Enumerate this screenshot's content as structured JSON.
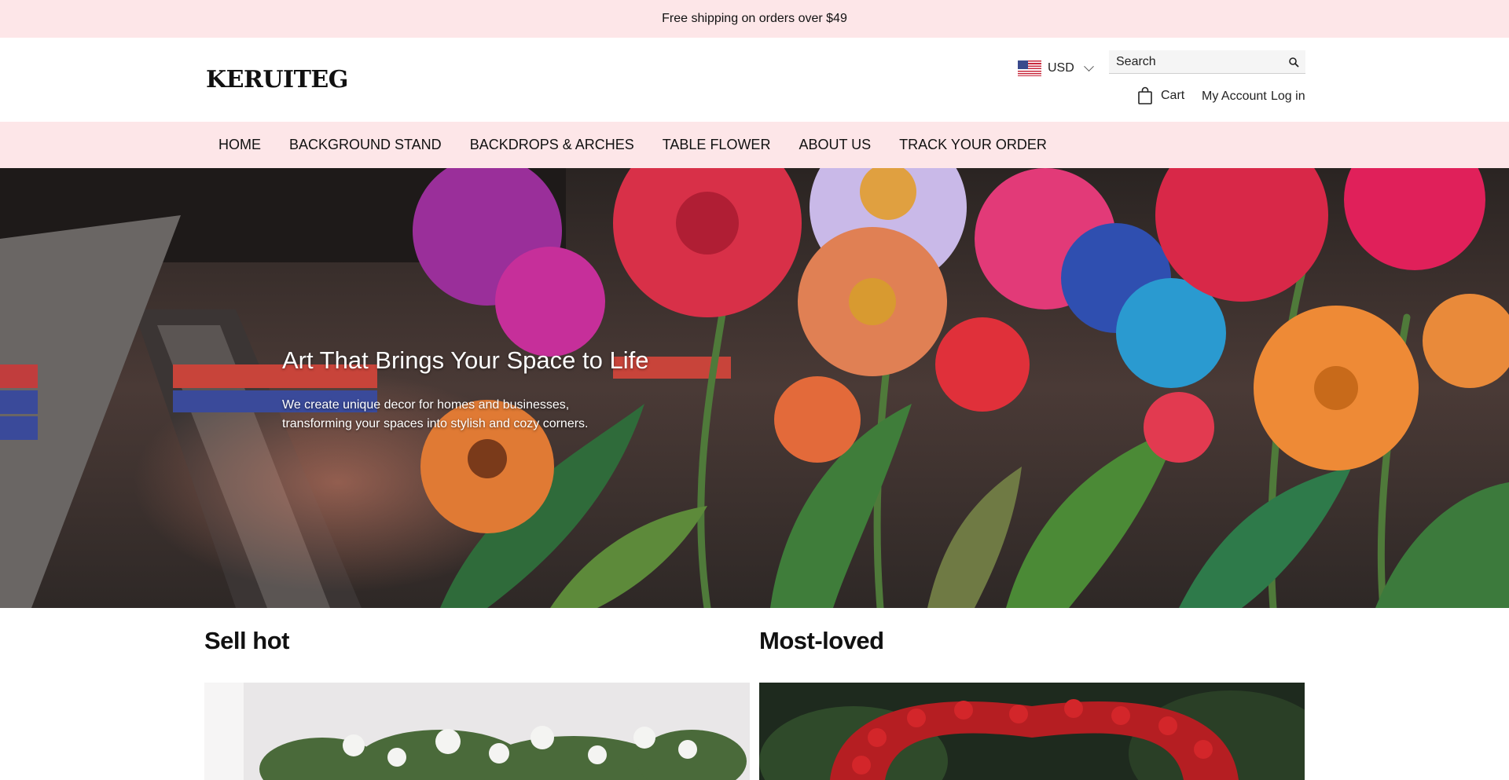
{
  "announcement": {
    "text": "Free shipping on orders over $49"
  },
  "header": {
    "logo": "KERUITEG",
    "currency": {
      "selected": "USD",
      "flag_icon": "us-flag-icon"
    },
    "search": {
      "placeholder": "Search"
    },
    "cart_label": "Cart",
    "account_label": "My Account",
    "login_label": "Log in"
  },
  "nav": {
    "items": [
      {
        "label": "HOME"
      },
      {
        "label": "BACKGROUND STAND"
      },
      {
        "label": "BACKDROPS & ARCHES"
      },
      {
        "label": "TABLE FLOWER"
      },
      {
        "label": "ABOUT US"
      },
      {
        "label": "TRACK YOUR ORDER"
      }
    ]
  },
  "hero": {
    "title": "Art That Brings Your Space to Life",
    "subtitle": "We create unique decor for homes and businesses, transforming your spaces into stylish and cozy corners."
  },
  "collections": [
    {
      "title": "Sell hot"
    },
    {
      "title": "Most-loved"
    }
  ],
  "colors": {
    "announcement_bg": "#fde6e8",
    "nav_bg": "#fde6e8",
    "text": "#111111"
  }
}
